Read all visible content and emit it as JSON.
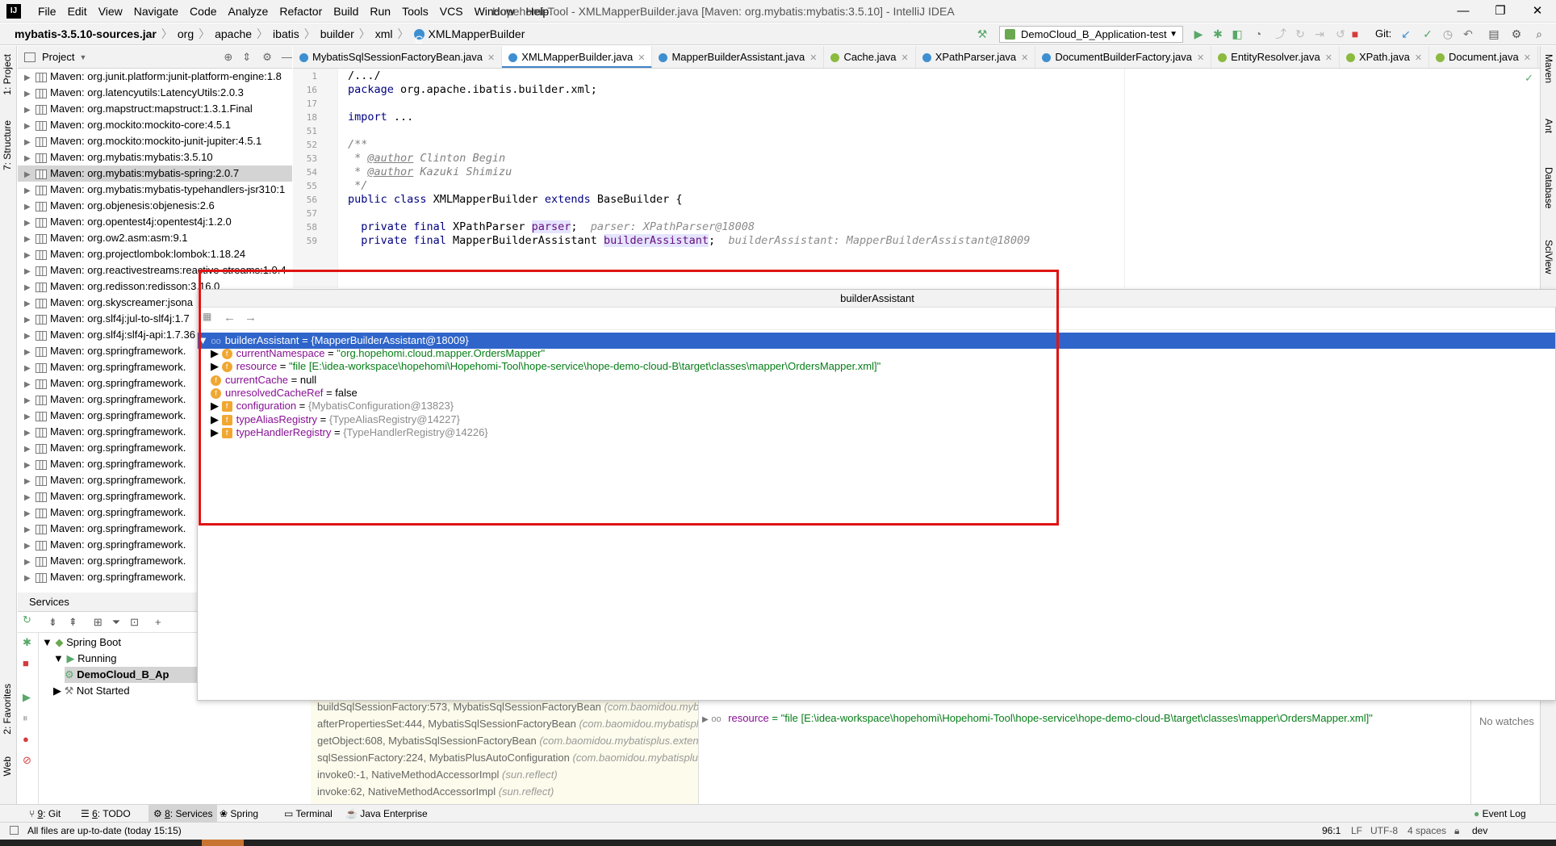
{
  "app": {
    "menus": [
      "File",
      "Edit",
      "View",
      "Navigate",
      "Code",
      "Analyze",
      "Refactor",
      "Build",
      "Run",
      "Tools",
      "VCS",
      "Window",
      "Help"
    ],
    "window_title": "Hopehomi-Tool - XMLMapperBuilder.java [Maven: org.mybatis:mybatis:3.5.10] - IntelliJ IDEA",
    "window_controls": [
      "—",
      "❐",
      "✕"
    ]
  },
  "breadcrumb": [
    "mybatis-3.5.10-sources.jar",
    "org",
    "apache",
    "ibatis",
    "builder",
    "xml",
    "XMLMapperBuilder"
  ],
  "toolbar": {
    "run_config": "DemoCloud_B_Application-test",
    "git_label": "Git:"
  },
  "side_left": {
    "project": "1: Project",
    "structure": "7: Structure",
    "favorites": "2: Favorites",
    "web": "Web"
  },
  "side_right": [
    "Maven",
    "Ant",
    "Database",
    "SciView"
  ],
  "project": {
    "title": "Project",
    "items": [
      "Maven: org.junit.platform:junit-platform-engine:1.8",
      "Maven: org.latencyutils:LatencyUtils:2.0.3",
      "Maven: org.mapstruct:mapstruct:1.3.1.Final",
      "Maven: org.mockito:mockito-core:4.5.1",
      "Maven: org.mockito:mockito-junit-jupiter:4.5.1",
      "Maven: org.mybatis:mybatis:3.5.10",
      "Maven: org.mybatis:mybatis-spring:2.0.7",
      "Maven: org.mybatis:mybatis-typehandlers-jsr310:1",
      "Maven: org.objenesis:objenesis:2.6",
      "Maven: org.opentest4j:opentest4j:1.2.0",
      "Maven: org.ow2.asm:asm:9.1",
      "Maven: org.projectlombok:lombok:1.18.24",
      "Maven: org.reactivestreams:reactive-streams:1.0.4",
      "Maven: org.redisson:redisson:3.16.0",
      "Maven: org.skyscreamer:jsona",
      "Maven: org.slf4j:jul-to-slf4j:1.7",
      "Maven: org.slf4j:slf4j-api:1.7.36",
      "Maven: org.springframework.",
      "Maven: org.springframework.",
      "Maven: org.springframework.",
      "Maven: org.springframework.",
      "Maven: org.springframework.",
      "Maven: org.springframework.",
      "Maven: org.springframework.",
      "Maven: org.springframework.",
      "Maven: org.springframework.",
      "Maven: org.springframework.",
      "Maven: org.springframework.",
      "Maven: org.springframework.",
      "Maven: org.springframework.",
      "Maven: org.springframework.",
      "Maven: org.springframework."
    ],
    "selected_index": 6
  },
  "tabs": [
    {
      "label": "MybatisSqlSessionFactoryBean.java",
      "icon": "class"
    },
    {
      "label": "XMLMapperBuilder.java",
      "icon": "class",
      "active": true
    },
    {
      "label": "MapperBuilderAssistant.java",
      "icon": "class"
    },
    {
      "label": "Cache.java",
      "icon": "interface"
    },
    {
      "label": "XPathParser.java",
      "icon": "class"
    },
    {
      "label": "DocumentBuilderFactory.java",
      "icon": "class"
    },
    {
      "label": "EntityResolver.java",
      "icon": "interface"
    },
    {
      "label": "XPath.java",
      "icon": "interface"
    },
    {
      "label": "Document.java",
      "icon": "interface"
    }
  ],
  "editor": {
    "lines": [
      {
        "no": "1",
        "text": "/.../"
      },
      {
        "no": "16",
        "kw": "package",
        "text": " org.apache.ibatis.builder.xml;"
      },
      {
        "no": "17",
        "text": ""
      },
      {
        "no": "18",
        "kw": "import",
        "text": " ..."
      },
      {
        "no": "51",
        "text": ""
      },
      {
        "no": "52",
        "text": "/**"
      },
      {
        "no": "53",
        "pre": " * ",
        "tag": "@author",
        "text": " Clinton Begin"
      },
      {
        "no": "54",
        "pre": " * ",
        "tag": "@author",
        "text": " Kazuki Shimizu"
      },
      {
        "no": "55",
        "text": " */"
      },
      {
        "no": "56",
        "kw": "public class",
        "text": " XMLMapperBuilder ",
        "kw2": "extends",
        "text2": " BaseBuilder {"
      },
      {
        "no": "57",
        "text": ""
      },
      {
        "no": "58",
        "kw": "  private final",
        "text": " XPathParser ",
        "field": "parser",
        "tail": ";",
        "hint": "  parser: XPathParser@18008"
      },
      {
        "no": "59",
        "kw": "  private final",
        "text": " MapperBuilderAssistant ",
        "field": "builderAssistant",
        "tail": ";",
        "hint": "  builderAssistant: MapperBuilderAssistant@18009"
      }
    ]
  },
  "popup": {
    "title": "builderAssistant",
    "root": {
      "name": "builderAssistant",
      "value": "{MapperBuilderAssistant@18009}"
    },
    "fields": [
      {
        "name": "currentNamespace",
        "eq": " = ",
        "value": "\"org.hopehomi.cloud.mapper.OrdersMapper\"",
        "kind": "str",
        "expandable": true
      },
      {
        "name": "resource",
        "eq": " = ",
        "value": "\"file [E:\\idea-workspace\\hopehomi\\Hopehomi-Tool\\hope-service\\hope-demo-cloud-B\\target\\classes\\mapper\\OrdersMapper.xml]\"",
        "kind": "str",
        "expandable": true
      },
      {
        "name": "currentCache",
        "eq": " = ",
        "value": "null",
        "kind": "plain",
        "expandable": false
      },
      {
        "name": "unresolvedCacheRef",
        "eq": " = ",
        "value": "false",
        "kind": "plain",
        "expandable": false
      },
      {
        "name": "configuration",
        "eq": " = ",
        "value": "{MybatisConfiguration@13823}",
        "kind": "obj",
        "expandable": true
      },
      {
        "name": "typeAliasRegistry",
        "eq": " = ",
        "value": "{TypeAliasRegistry@14227}",
        "kind": "obj",
        "expandable": true
      },
      {
        "name": "typeHandlerRegistry",
        "eq": " = ",
        "value": "{TypeHandlerRegistry@14226}",
        "kind": "obj",
        "expandable": true
      }
    ]
  },
  "services": {
    "title": "Services",
    "tree": [
      {
        "label": "Spring Boot",
        "level": 0
      },
      {
        "label": "Running",
        "level": 1
      },
      {
        "label": "DemoCloud_B_Ap",
        "level": 2,
        "bold": true
      },
      {
        "label": "Not Started",
        "level": 1
      }
    ]
  },
  "frames": [
    {
      "method": "buildSqlSessionFactory:573, MybatisSqlSessionFactoryBean ",
      "pkg": "(com.baomidou.mybat"
    },
    {
      "method": "afterPropertiesSet:444, MybatisSqlSessionFactoryBean ",
      "pkg": "(com.baomidou.mybatispl"
    },
    {
      "method": "getObject:608, MybatisSqlSessionFactoryBean ",
      "pkg": "(com.baomidou.mybatisplus.exten"
    },
    {
      "method": "sqlSessionFactory:224, MybatisPlusAutoConfiguration ",
      "pkg": "(com.baomidou.mybatisplu"
    },
    {
      "method": "invoke0:-1, NativeMethodAccessorImpl ",
      "pkg": "(sun.reflect)"
    },
    {
      "method": "invoke:62, NativeMethodAccessorImpl ",
      "pkg": "(sun.reflect)"
    }
  ],
  "variables": {
    "name": "resource",
    "value": "= \"file [E:\\idea-workspace\\hopehomi\\Hopehomi-Tool\\hope-service\\hope-demo-cloud-B\\target\\classes\\mapper\\OrdersMapper.xml]\""
  },
  "watches": {
    "empty": "No watches"
  },
  "bottom_tabs": [
    {
      "num": "9",
      "label": ": Git"
    },
    {
      "num": "6",
      "label": ": TODO"
    },
    {
      "num": "8",
      "label": ": Services",
      "active": true
    },
    {
      "num": "",
      "label": "Spring"
    },
    {
      "num": "",
      "label": "Terminal"
    },
    {
      "num": "",
      "label": "Java Enterprise"
    }
  ],
  "event_log": "Event Log",
  "status": {
    "message": "All files are up-to-date (today 15:15)",
    "position": "96:1",
    "line_sep": "LF",
    "encoding": "UTF-8",
    "indent": "4 spaces",
    "branch": "dev"
  },
  "colors": {
    "selection": "#2f65ca",
    "highlight_box": "#e01313",
    "string": "#067d17",
    "field": "#871094"
  }
}
